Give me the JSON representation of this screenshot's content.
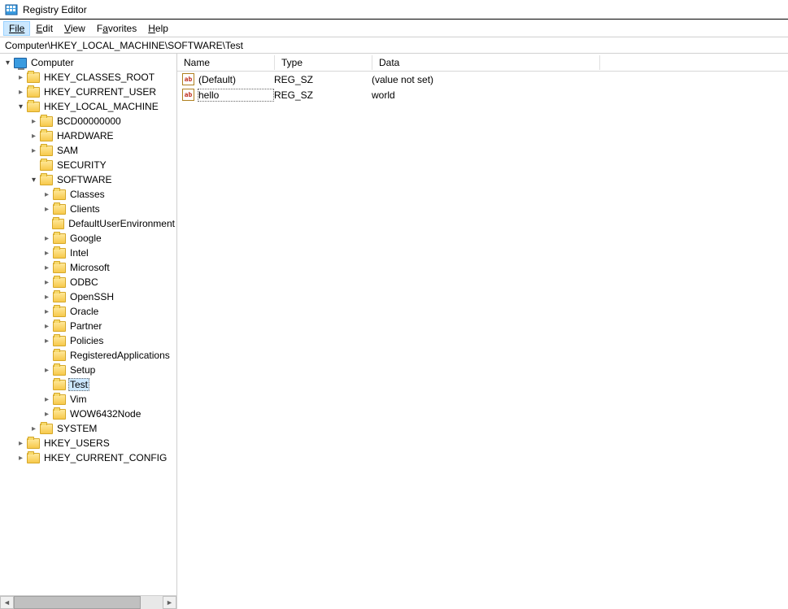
{
  "window": {
    "title": "Registry Editor"
  },
  "menu": {
    "file": "File",
    "edit": "Edit",
    "view": "View",
    "favorites": "Favorites",
    "help": "Help"
  },
  "address": "Computer\\HKEY_LOCAL_MACHINE\\SOFTWARE\\Test",
  "tree": [
    {
      "label": "Computer",
      "depth": 0,
      "icon": "pc",
      "exp": "exp"
    },
    {
      "label": "HKEY_CLASSES_ROOT",
      "depth": 1,
      "icon": "folder",
      "exp": "col"
    },
    {
      "label": "HKEY_CURRENT_USER",
      "depth": 1,
      "icon": "folder",
      "exp": "col"
    },
    {
      "label": "HKEY_LOCAL_MACHINE",
      "depth": 1,
      "icon": "folder",
      "exp": "exp"
    },
    {
      "label": "BCD00000000",
      "depth": 2,
      "icon": "folder",
      "exp": "col"
    },
    {
      "label": "HARDWARE",
      "depth": 2,
      "icon": "folder",
      "exp": "col"
    },
    {
      "label": "SAM",
      "depth": 2,
      "icon": "folder",
      "exp": "col"
    },
    {
      "label": "SECURITY",
      "depth": 2,
      "icon": "folder",
      "exp": "none"
    },
    {
      "label": "SOFTWARE",
      "depth": 2,
      "icon": "folder",
      "exp": "exp"
    },
    {
      "label": "Classes",
      "depth": 3,
      "icon": "folder",
      "exp": "col"
    },
    {
      "label": "Clients",
      "depth": 3,
      "icon": "folder",
      "exp": "col"
    },
    {
      "label": "DefaultUserEnvironment",
      "depth": 3,
      "icon": "folder",
      "exp": "none"
    },
    {
      "label": "Google",
      "depth": 3,
      "icon": "folder",
      "exp": "col"
    },
    {
      "label": "Intel",
      "depth": 3,
      "icon": "folder",
      "exp": "col"
    },
    {
      "label": "Microsoft",
      "depth": 3,
      "icon": "folder",
      "exp": "col"
    },
    {
      "label": "ODBC",
      "depth": 3,
      "icon": "folder",
      "exp": "col"
    },
    {
      "label": "OpenSSH",
      "depth": 3,
      "icon": "folder",
      "exp": "col"
    },
    {
      "label": "Oracle",
      "depth": 3,
      "icon": "folder",
      "exp": "col"
    },
    {
      "label": "Partner",
      "depth": 3,
      "icon": "folder",
      "exp": "col"
    },
    {
      "label": "Policies",
      "depth": 3,
      "icon": "folder",
      "exp": "col"
    },
    {
      "label": "RegisteredApplications",
      "depth": 3,
      "icon": "folder",
      "exp": "none"
    },
    {
      "label": "Setup",
      "depth": 3,
      "icon": "folder",
      "exp": "col"
    },
    {
      "label": "Test",
      "depth": 3,
      "icon": "folder",
      "exp": "none",
      "selected": true
    },
    {
      "label": "Vim",
      "depth": 3,
      "icon": "folder",
      "exp": "col"
    },
    {
      "label": "WOW6432Node",
      "depth": 3,
      "icon": "folder",
      "exp": "col"
    },
    {
      "label": "SYSTEM",
      "depth": 2,
      "icon": "folder",
      "exp": "col"
    },
    {
      "label": "HKEY_USERS",
      "depth": 1,
      "icon": "folder",
      "exp": "col"
    },
    {
      "label": "HKEY_CURRENT_CONFIG",
      "depth": 1,
      "icon": "folder",
      "exp": "col"
    }
  ],
  "columns": {
    "name": "Name",
    "type": "Type",
    "data": "Data"
  },
  "values": [
    {
      "name": "(Default)",
      "type": "REG_SZ",
      "data": "(value not set)",
      "icon": "ab",
      "selected": false
    },
    {
      "name": "hello",
      "type": "REG_SZ",
      "data": "world",
      "icon": "ab",
      "selected": true
    }
  ]
}
